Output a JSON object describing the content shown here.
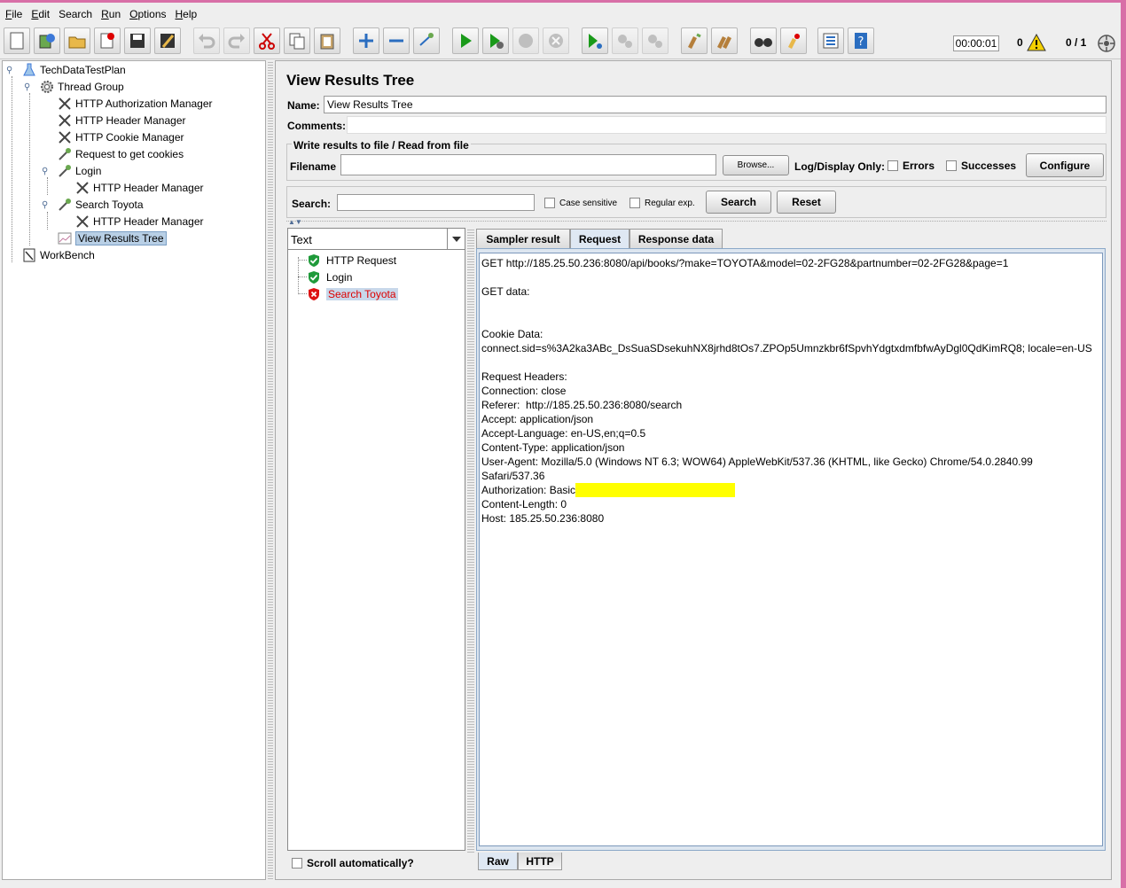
{
  "menu": {
    "items": [
      {
        "mnemonic": "F",
        "rest": "ile"
      },
      {
        "mnemonic": "E",
        "rest": "dit"
      },
      {
        "mnemonic": "",
        "rest": "Search"
      },
      {
        "mnemonic": "R",
        "rest": "un"
      },
      {
        "mnemonic": "O",
        "rest": "ptions"
      },
      {
        "mnemonic": "H",
        "rest": "elp"
      }
    ]
  },
  "toolbar": {
    "timer": "00:00:01",
    "error_count": "0",
    "threads": "0 / 1"
  },
  "tree": {
    "nodes": [
      {
        "label": "TechDataTestPlan"
      },
      {
        "label": "Thread Group"
      },
      {
        "label": "HTTP Authorization Manager"
      },
      {
        "label": "HTTP Header Manager"
      },
      {
        "label": "HTTP Cookie Manager"
      },
      {
        "label": "Request to get cookies"
      },
      {
        "label": "Login"
      },
      {
        "label": "HTTP Header Manager"
      },
      {
        "label": "Search Toyota"
      },
      {
        "label": "HTTP Header Manager"
      },
      {
        "label": "View Results Tree"
      },
      {
        "label": "WorkBench"
      }
    ]
  },
  "panel": {
    "title": "View Results Tree",
    "name_label": "Name:",
    "name_value": "View Results Tree",
    "comments_label": "Comments:",
    "file_group_title": "Write results to file / Read from file",
    "filename_label": "Filename",
    "browse_label": "Browse...",
    "logdisplay_label": "Log/Display Only:",
    "errors_label": "Errors",
    "successes_label": "Successes",
    "configure_label": "Configure",
    "search_label": "Search:",
    "case_sensitive_label": "Case sensitive",
    "regular_exp_label": "Regular exp.",
    "search_button": "Search",
    "reset_button": "Reset"
  },
  "results": {
    "renderer": "Text",
    "items": [
      {
        "label": "HTTP Request",
        "status": "success"
      },
      {
        "label": "Login",
        "status": "success"
      },
      {
        "label": "Search Toyota",
        "status": "error"
      }
    ],
    "scroll_auto_label": "Scroll automatically?"
  },
  "detail": {
    "tabs": [
      "Sampler result",
      "Request",
      "Response data"
    ],
    "active_tab": "Request",
    "bottom_tabs": [
      "Raw",
      "HTTP"
    ],
    "lines": [
      "GET http://185.25.50.236:8080/api/books/?make=TOYOTA&model=02-2FG28&partnumber=02-2FG28&page=1",
      "",
      "GET data:",
      "",
      "",
      "Cookie Data:",
      "connect.sid=s%3A2ka3ABc_DsSuaSDsekuhNX8jrhd8tOs7.ZPOp5Umnzkbr6fSpvhYdgtxdmfbfwAyDgl0QdKimRQ8; locale=en-US",
      "",
      "Request Headers:",
      "Connection: close",
      "Referer:  http://185.25.50.236:8080/search",
      "Accept: application/json",
      "Accept-Language: en-US,en;q=0.5",
      "Content-Type: application/json",
      "User-Agent: Mozilla/5.0 (Windows NT 6.3; WOW64) AppleWebKit/537.36 (KHTML, like Gecko) Chrome/54.0.2840.99",
      "Safari/537.36",
      "Authorization: Basic",
      "Content-Length: 0",
      "Host: 185.25.50.236:8080"
    ]
  }
}
